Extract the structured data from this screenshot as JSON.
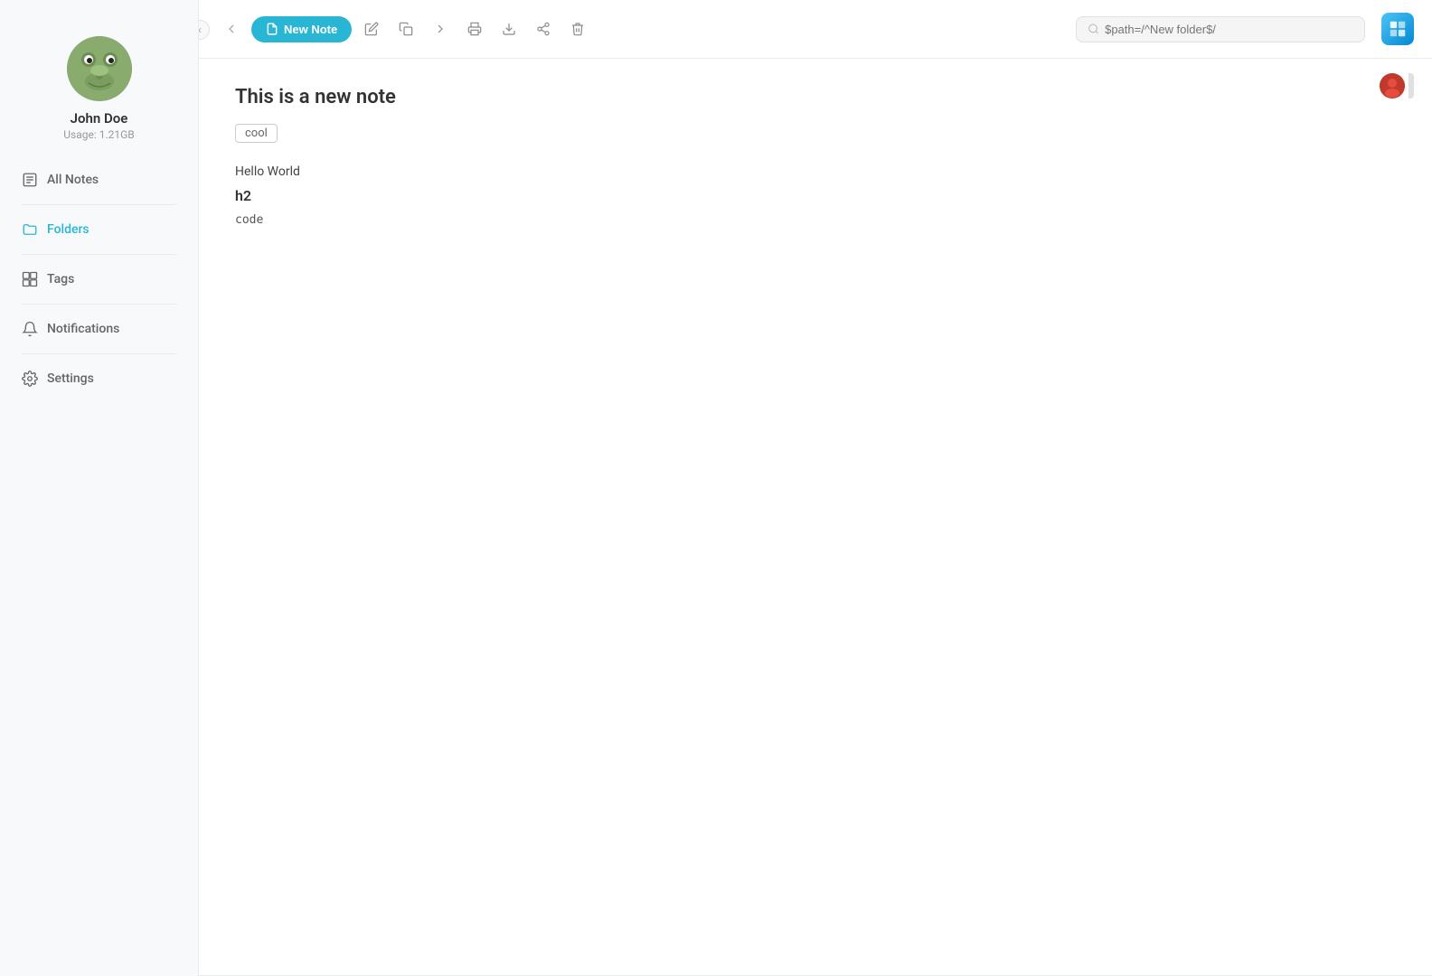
{
  "sidebar": {
    "user": {
      "name": "John Doe",
      "usage": "Usage: 1.21GB"
    },
    "nav_items": [
      {
        "id": "all-notes",
        "label": "All Notes",
        "icon": "notes-icon",
        "active": false
      },
      {
        "id": "folders",
        "label": "Folders",
        "icon": "folders-icon",
        "active": true
      },
      {
        "id": "tags",
        "label": "Tags",
        "icon": "tags-icon",
        "active": false
      },
      {
        "id": "notifications",
        "label": "Notifications",
        "icon": "notifications-icon",
        "active": false
      },
      {
        "id": "settings",
        "label": "Settings",
        "icon": "settings-icon",
        "active": false
      }
    ]
  },
  "toolbar": {
    "new_note_label": "New Note",
    "search_placeholder": "$path=/^New folder$/"
  },
  "note": {
    "title": "This is a new note",
    "tag": "cool",
    "body_line1": "Hello World",
    "body_line2": "h2",
    "body_line3": "code"
  }
}
